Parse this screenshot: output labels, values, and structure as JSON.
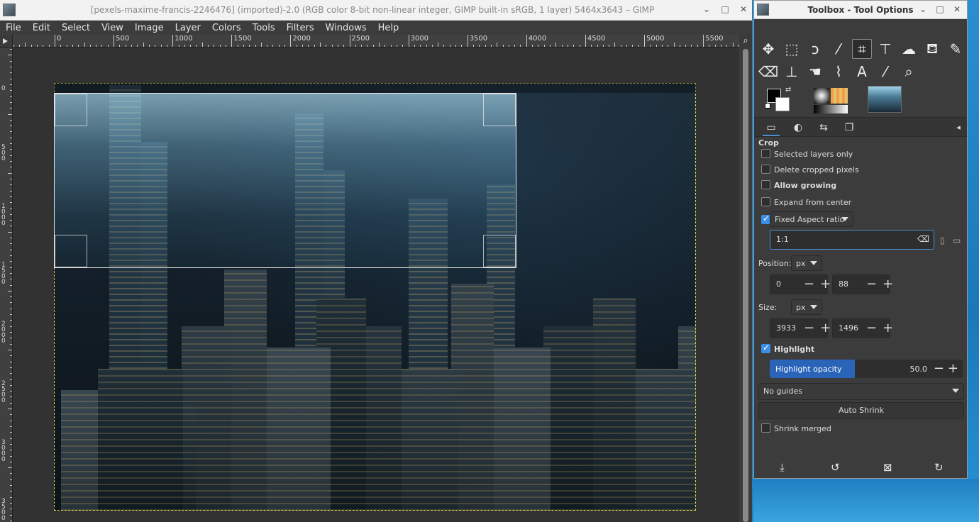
{
  "main_window": {
    "title": "[pexels-maxime-francis-2246476] (imported)-2.0 (RGB color 8-bit non-linear integer, GIMP built-in sRGB, 1 layer) 5464x3643 – GIMP",
    "window_buttons": {
      "minimize": "⌄",
      "maximize": "□",
      "close": "✕"
    }
  },
  "menubar": [
    "File",
    "Edit",
    "Select",
    "View",
    "Image",
    "Layer",
    "Colors",
    "Tools",
    "Filters",
    "Windows",
    "Help"
  ],
  "ruler": {
    "h_labels": [
      "0",
      "500",
      "1000",
      "1500",
      "2000",
      "2500",
      "3000",
      "3500",
      "4000",
      "4500",
      "5000",
      "5500"
    ],
    "v_labels": [
      "0",
      "5\n0\n0",
      "1\n0\n0\n0",
      "1\n5\n0\n0",
      "2\n0\n0\n0",
      "2\n5\n0\n0",
      "3\n0\n0\n0",
      "3\n5\n0\n0"
    ]
  },
  "toolbox": {
    "title": "Toolbox - Tool Options",
    "window_buttons": {
      "minimize": "⌄",
      "maximize": "□",
      "close": "✕"
    },
    "tools": [
      {
        "name": "move-tool-icon",
        "glyph": "✥"
      },
      {
        "name": "rect-select-tool-icon",
        "glyph": "⬚"
      },
      {
        "name": "free-select-tool-icon",
        "glyph": "ↄ"
      },
      {
        "name": "fuzzy-select-tool-icon",
        "glyph": "⁄"
      },
      {
        "name": "crop-tool-icon",
        "glyph": "⌗",
        "active": true
      },
      {
        "name": "transform-tool-icon",
        "glyph": "⊤"
      },
      {
        "name": "warp-tool-icon",
        "glyph": "☁"
      },
      {
        "name": "bucket-fill-tool-icon",
        "glyph": "⛾"
      },
      {
        "name": "paintbrush-tool-icon",
        "glyph": "✎"
      },
      {
        "name": "eraser-tool-icon",
        "glyph": "⌫"
      },
      {
        "name": "clone-tool-icon",
        "glyph": "⊥"
      },
      {
        "name": "smudge-tool-icon",
        "glyph": "☚"
      },
      {
        "name": "paths-tool-icon",
        "glyph": "⌇"
      },
      {
        "name": "text-tool-icon",
        "glyph": "A"
      },
      {
        "name": "color-picker-tool-icon",
        "glyph": "⁄"
      },
      {
        "name": "zoom-tool-icon",
        "glyph": "⌕"
      }
    ],
    "tabs": [
      "tool-options-tab",
      "device-status-tab",
      "undo-history-tab",
      "images-tab"
    ],
    "options": {
      "section": "Crop",
      "selected_layers_only": "Selected layers only",
      "delete_cropped_pixels": "Delete cropped pixels",
      "allow_growing": "Allow growing",
      "expand_from_center": "Expand from center",
      "fixed_label": "Fixed",
      "fixed_mode": "Aspect ratio",
      "ratio_value": "1:1",
      "position_label": "Position:",
      "position_unit": "px",
      "position_x": "0",
      "position_y": "88",
      "size_label": "Size:",
      "size_unit": "px",
      "size_w": "3933",
      "size_h": "1496",
      "highlight": "Highlight",
      "highlight_opacity_label": "Highlight opacity",
      "highlight_opacity_value": "50.0",
      "guides": "No guides",
      "auto_shrink": "Auto Shrink",
      "shrink_merged": "Shrink merged",
      "checks": {
        "selected_layers_only": false,
        "delete_cropped_pixels": false,
        "allow_growing": false,
        "expand_from_center": false,
        "fixed": true,
        "highlight": true,
        "shrink_merged": false
      }
    },
    "bottom_actions": [
      {
        "name": "save-options-icon",
        "glyph": "⤓"
      },
      {
        "name": "restore-options-icon",
        "glyph": "↺"
      },
      {
        "name": "delete-options-icon",
        "glyph": "⊠"
      },
      {
        "name": "reset-options-icon",
        "glyph": "↻"
      }
    ]
  },
  "colors": {
    "accent": "#2a64b8",
    "selection_border": "#d6d64a"
  }
}
